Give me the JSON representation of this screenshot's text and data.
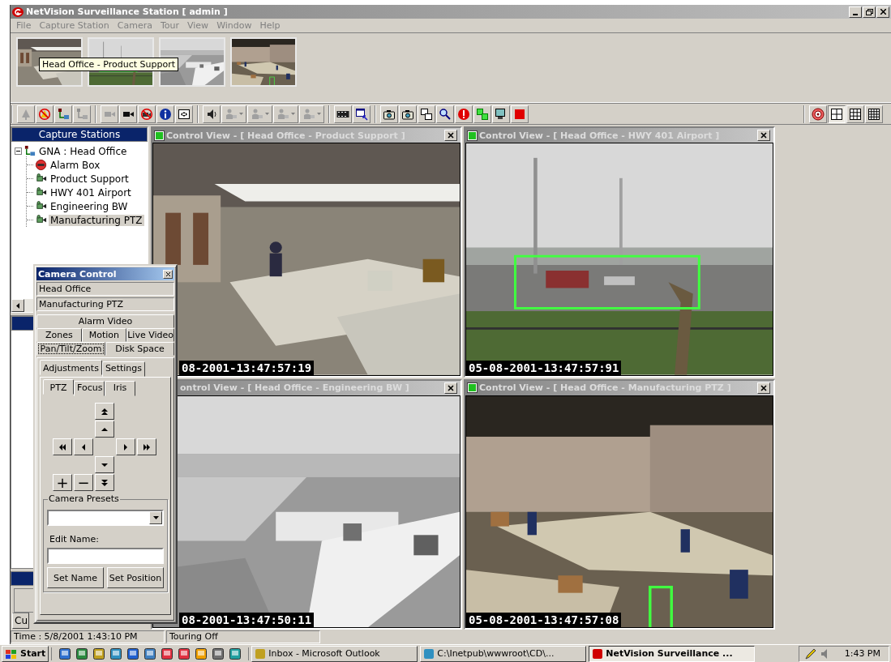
{
  "window": {
    "title": "NetVision Surveillance Station [ admin ]"
  },
  "menu": [
    "File",
    "Capture Station",
    "Camera",
    "Tour",
    "View",
    "Window",
    "Help"
  ],
  "thumbnails": [
    {
      "kind": "picture"
    },
    {
      "kind": "picture"
    },
    {
      "kind": "picture"
    },
    {
      "kind": "picture"
    }
  ],
  "tooltip": "Head Office - Product Support",
  "view_layouts": [
    {
      "selected": false
    },
    {
      "selected": true
    },
    {
      "selected": false
    },
    {
      "selected": false
    }
  ],
  "capture_stations": {
    "title": "Capture Stations",
    "tree": [
      {
        "label": "GNA : Head Office",
        "kind": "station",
        "expanded": true,
        "selected": false,
        "children": [
          {
            "label": "Alarm Box",
            "kind": "alarm",
            "selected": false
          },
          {
            "label": "Product Support",
            "kind": "camera",
            "selected": false
          },
          {
            "label": "HWY 401 Airport",
            "kind": "camera",
            "selected": false
          },
          {
            "label": "Engineering BW",
            "kind": "camera",
            "selected": false
          },
          {
            "label": "Manufacturing PTZ",
            "kind": "camera",
            "selected": true
          }
        ]
      }
    ]
  },
  "side_tab": "Cu",
  "tiles": [
    {
      "title": "Control View - [ Head Office - Product Support ]",
      "timestamp": "08-2001-13:47:57:19"
    },
    {
      "title": "Control View - [ Head Office - HWY 401 Airport ]",
      "timestamp": "05-08-2001-13:47:57:91"
    },
    {
      "title": "ontrol View - [ Head Office - Engineering BW ]",
      "timestamp": "08-2001-13:47:50:11"
    },
    {
      "title": "Control View - [ Head Office - Manufacturing PTZ ]",
      "timestamp": "05-08-2001-13:47:57:08"
    }
  ],
  "camera_control": {
    "title": "Camera Control",
    "site": "Head Office",
    "camera": "Manufacturing PTZ",
    "tab_rows": [
      [
        {
          "label": "Alarm Video",
          "selected": false
        }
      ],
      [
        {
          "label": "Zones",
          "selected": false
        },
        {
          "label": "Motion",
          "selected": false
        },
        {
          "label": "Live Video",
          "selected": false
        }
      ],
      [
        {
          "label": "Pan/Tilt/Zoom",
          "selected": true
        },
        {
          "label": "Disk Space",
          "selected": false
        }
      ]
    ],
    "sub_tabs": [
      {
        "label": "Adjustments",
        "selected": true
      },
      {
        "label": "Settings",
        "selected": false
      }
    ],
    "ptz_tabs": [
      {
        "label": "PTZ",
        "selected": true
      },
      {
        "label": "Focus",
        "selected": false
      },
      {
        "label": "Iris",
        "selected": false
      }
    ],
    "zoom_buttons": [
      "+",
      "−"
    ],
    "presets_title": "Camera Presets",
    "edit_label": "Edit Name:",
    "buttons": [
      "Set Name",
      "Set Position"
    ]
  },
  "status_bar": [
    "Time : 5/8/2001 1:43:10 PM",
    "Touring Off"
  ],
  "taskbar": {
    "start": "Start",
    "tasks": [
      {
        "label": "Inbox - Microsoft Outlook",
        "selected": false
      },
      {
        "label": "C:\\Inetpub\\wwwroot\\CD\\...",
        "selected": false
      },
      {
        "label": "NetVision Surveillance ...",
        "selected": true
      }
    ],
    "clock": "1:43 PM"
  }
}
